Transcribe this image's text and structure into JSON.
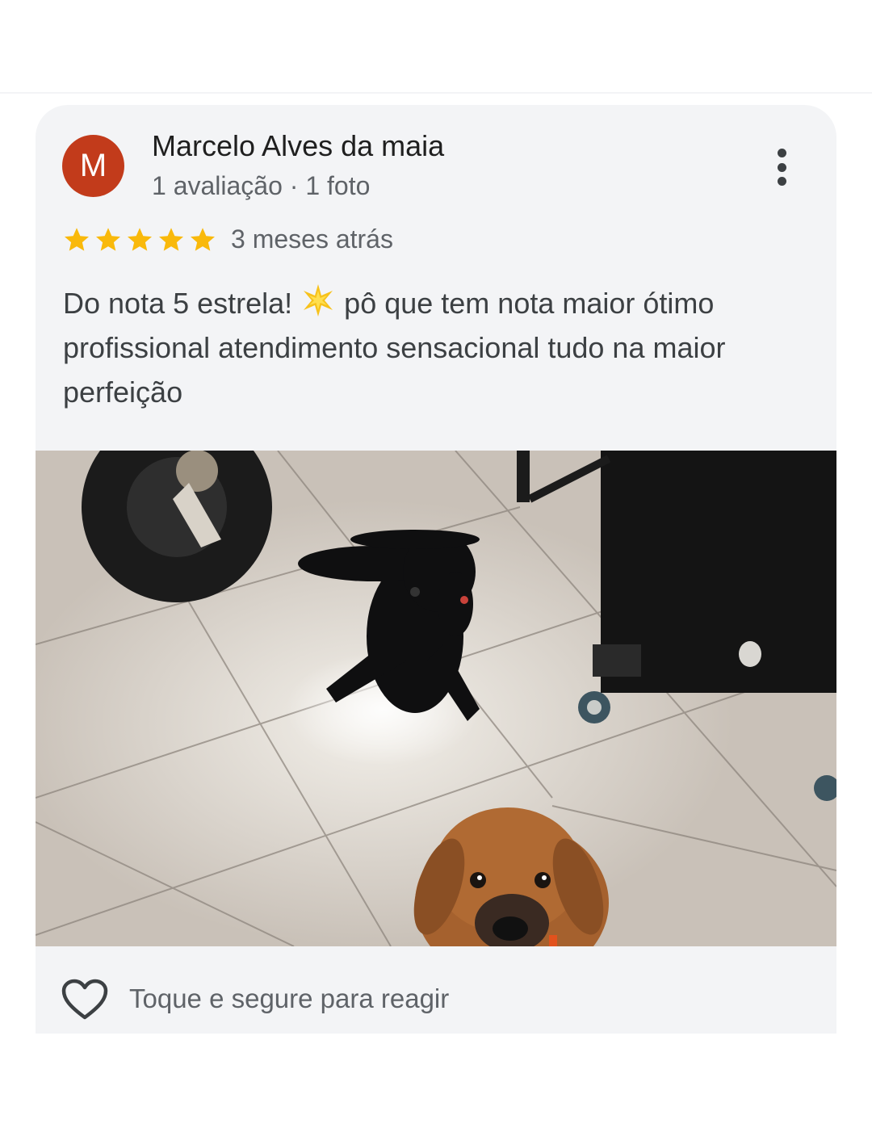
{
  "review": {
    "avatar_letter": "M",
    "avatar_color": "#c23b1b",
    "reviewer_name": "Marcelo Alves da maia",
    "reviewer_meta": "1 avaliação · 1 foto",
    "rating": 5,
    "rating_max": 5,
    "date": "3 meses atrás",
    "text_before_emoji": "Do nota 5 estrela! ",
    "emoji": "sparkle-star",
    "text_after_emoji": " pô que tem nota maior ótimo profissional atendimento sensacional tudo na maior perfeição",
    "photo_icon": "review-photo-dogs",
    "more_icon": "more-vert-icon"
  },
  "reaction": {
    "icon": "heart-outline-icon",
    "label": "Toque e segure para reagir"
  },
  "colors": {
    "star": "#f9b90b",
    "card_bg": "#f3f4f6",
    "text_primary": "#1f1f1f",
    "text_secondary": "#5f6368"
  }
}
